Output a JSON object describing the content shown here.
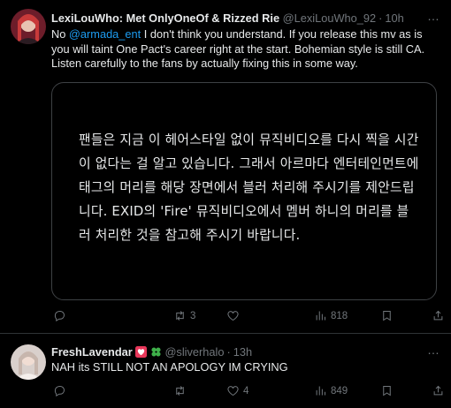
{
  "tweet1": {
    "name": "LexiLouWho: Met OnlyOneOf & Rizzed Rie",
    "handle": "@LexiLouWho_92",
    "time": "10h",
    "text_before_mention": "No ",
    "mention": "@armada_ent",
    "text_after_mention": " I don't think you understand. If you release this mv as is you will taint One Pact's career right at the start. Bohemian style is still CA. Listen carefully to the fans by actually fixing this in some way.",
    "image_text": "팬들은 지금 이 헤어스타일 없이 뮤직비디오를 다시 찍을 시간이 없다는 걸 알고 있습니다. 그래서 아르마다 엔터테인먼트에 태그의 머리를 해당 장면에서 블러 처리해 주시기를 제안드립니다. EXID의 'Fire' 뮤직비디오에서 멤버 하니의 머리를 블러 처리한 것을 참고해 주시기 바랍니다.",
    "retweets": "3",
    "likes": "",
    "views": "818"
  },
  "tweet2": {
    "name": "FreshLavendar",
    "handle": "@sliverhalo",
    "time": "13h",
    "text": "NAH its STILL NOT AN APOLOGY IM CRYING",
    "retweets": "",
    "likes": "4",
    "views": "849",
    "name_badges": [
      "heart-badge-icon",
      "four-leaf-clover-icon"
    ]
  },
  "icons": {
    "more": "…",
    "reply": "reply-icon",
    "retweet": "retweet-icon",
    "like": "heart-icon",
    "views": "views-icon",
    "bookmark": "bookmark-icon",
    "share": "share-icon"
  },
  "colors": {
    "background": "#000000",
    "text": "#e7e9ea",
    "muted": "#71767b",
    "link": "#1d9bf0",
    "divider": "#2f3336"
  }
}
